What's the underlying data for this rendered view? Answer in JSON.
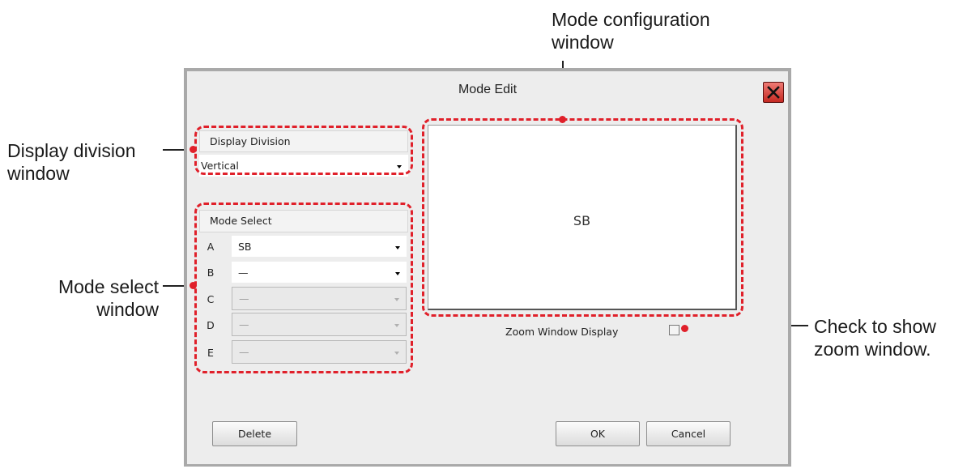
{
  "callouts": {
    "mode_config": [
      "Mode configuration",
      "window"
    ],
    "display_division": [
      "Display division",
      "window"
    ],
    "mode_select": [
      "Mode select",
      "window"
    ],
    "zoom": [
      "Check to show",
      "zoom window."
    ]
  },
  "dialog": {
    "title": "Mode Edit",
    "display_division": {
      "header": "Display Division",
      "value": "Vertical"
    },
    "mode_select": {
      "header": "Mode Select",
      "rows": [
        {
          "label": "A",
          "value": "SB",
          "enabled": true
        },
        {
          "label": "B",
          "value": "—",
          "enabled": true
        },
        {
          "label": "C",
          "value": "—",
          "enabled": false
        },
        {
          "label": "D",
          "value": "—",
          "enabled": false
        },
        {
          "label": "E",
          "value": "—",
          "enabled": false
        }
      ]
    },
    "preview": {
      "mode_text": "SB"
    },
    "zoom_window": {
      "label": "Zoom Window Display",
      "checked": false
    },
    "buttons": {
      "delete": "Delete",
      "ok": "OK",
      "cancel": "Cancel"
    }
  },
  "colors": {
    "highlight": "#e0202a",
    "close_button": "#d9453e"
  }
}
